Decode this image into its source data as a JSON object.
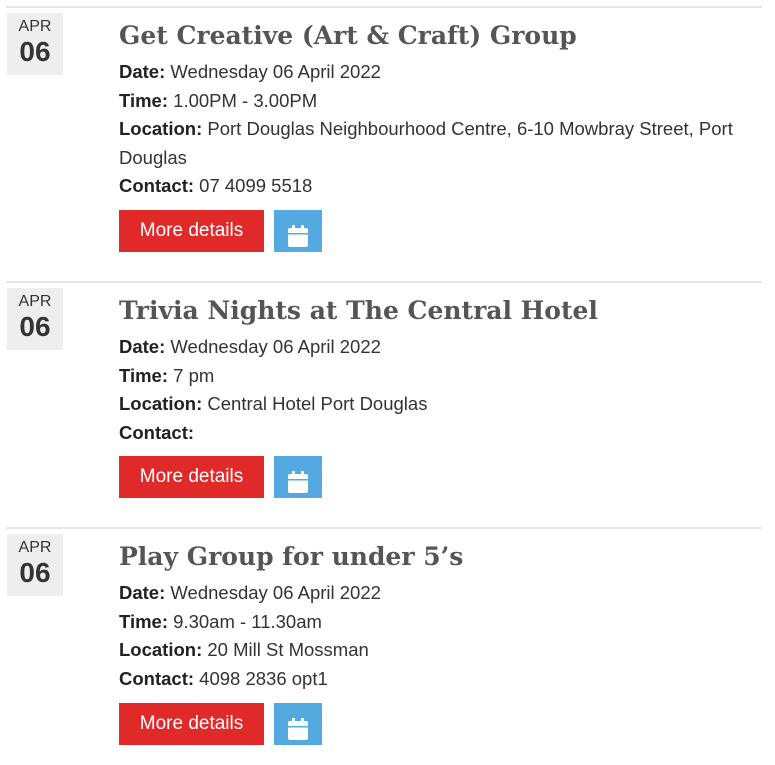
{
  "events": [
    {
      "month": "APR",
      "day": "06",
      "title": "Get Creative (Art & Craft) Group",
      "date_label": "Date:",
      "date_value": "Wednesday 06 April 2022",
      "time_label": "Time:",
      "time_value": "1.00PM - 3.00PM",
      "location_label": "Location:",
      "location_value": "Port Douglas Neighbourhood Centre, 6-10 Mowbray Street, Port Douglas",
      "contact_label": "Contact:",
      "contact_value": "07 4099 5518",
      "more_label": "More details",
      "calendar_icon": "calendar-icon"
    },
    {
      "month": "APR",
      "day": "06",
      "title": "Trivia Nights at The Central Hotel",
      "date_label": "Date:",
      "date_value": "Wednesday 06 April 2022",
      "time_label": "Time:",
      "time_value": "7 pm",
      "location_label": "Location:",
      "location_value": "Central Hotel Port Douglas",
      "contact_label": "Contact:",
      "contact_value": "",
      "more_label": "More details",
      "calendar_icon": "calendar-icon"
    },
    {
      "month": "APR",
      "day": "06",
      "title": "Play Group for under 5’s",
      "date_label": "Date:",
      "date_value": "Wednesday 06 April 2022",
      "time_label": "Time:",
      "time_value": "9.30am - 11.30am",
      "location_label": "Location:",
      "location_value": "20 Mill St Mossman",
      "contact_label": "Contact:",
      "contact_value": "4098 2836 opt1",
      "more_label": "More details",
      "calendar_icon": "calendar-icon"
    }
  ],
  "colors": {
    "more_button": "#e02a2a",
    "calendar_button": "#54a9e0",
    "date_badge": "#eeeeee",
    "title_text": "#555555"
  }
}
